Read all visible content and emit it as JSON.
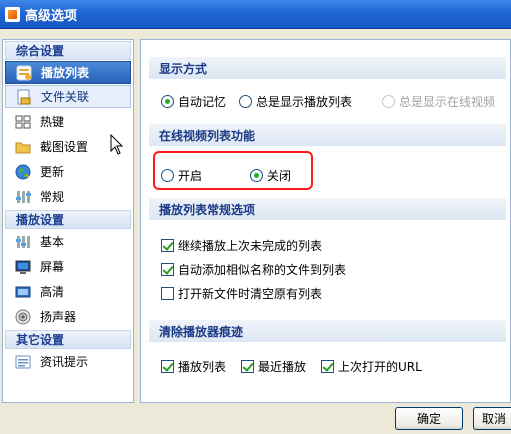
{
  "window": {
    "title": "高级选项"
  },
  "sidebar": {
    "categories": [
      {
        "label": "综合设置",
        "items": [
          {
            "label": "播放列表",
            "icon": "playlist-icon",
            "state": "selected"
          },
          {
            "label": "文件关联",
            "icon": "file-association-icon",
            "state": "hover"
          },
          {
            "label": "热键",
            "icon": "hotkey-icon"
          },
          {
            "label": "截图设置",
            "icon": "screenshot-folder-icon"
          },
          {
            "label": "更新",
            "icon": "update-globe-icon"
          },
          {
            "label": "常规",
            "icon": "general-settings-icon"
          }
        ]
      },
      {
        "label": "播放设置",
        "items": [
          {
            "label": "基本",
            "icon": "basic-sliders-icon"
          },
          {
            "label": "屏幕",
            "icon": "screen-monitor-icon"
          },
          {
            "label": "高清",
            "icon": "hd-icon"
          },
          {
            "label": "扬声器",
            "icon": "speaker-icon"
          }
        ]
      },
      {
        "label": "其它设置",
        "items": [
          {
            "label": "资讯提示",
            "icon": "news-tips-icon"
          }
        ]
      }
    ]
  },
  "display_mode": {
    "title": "显示方式",
    "options": [
      {
        "label": "自动记忆",
        "checked": true,
        "disabled": false
      },
      {
        "label": "总是显示播放列表",
        "checked": false,
        "disabled": false
      },
      {
        "label": "总是显示在线视频",
        "checked": false,
        "disabled": true
      }
    ]
  },
  "online_list": {
    "title": "在线视频列表功能",
    "options": [
      {
        "label": "开启",
        "checked": false
      },
      {
        "label": "关闭",
        "checked": true
      }
    ]
  },
  "playlist_options": {
    "title": "播放列表常规选项",
    "options": [
      {
        "label": "继续播放上次未完成的列表",
        "checked": true
      },
      {
        "label": "自动添加相似名称的文件到列表",
        "checked": true
      },
      {
        "label": "打开新文件时清空原有列表",
        "checked": false
      }
    ]
  },
  "clear_traces": {
    "title": "清除播放器痕迹",
    "options": [
      {
        "label": "播放列表",
        "checked": true
      },
      {
        "label": "最近播放",
        "checked": true
      },
      {
        "label": "上次打开的URL",
        "checked": true
      }
    ]
  },
  "buttons": {
    "ok": "确定",
    "cancel": "取消"
  },
  "colors": {
    "title_bar": "#1f66d3",
    "selection": "#2a62b8",
    "highlight_box": "#ff1a1a",
    "check_green": "#23b123"
  }
}
